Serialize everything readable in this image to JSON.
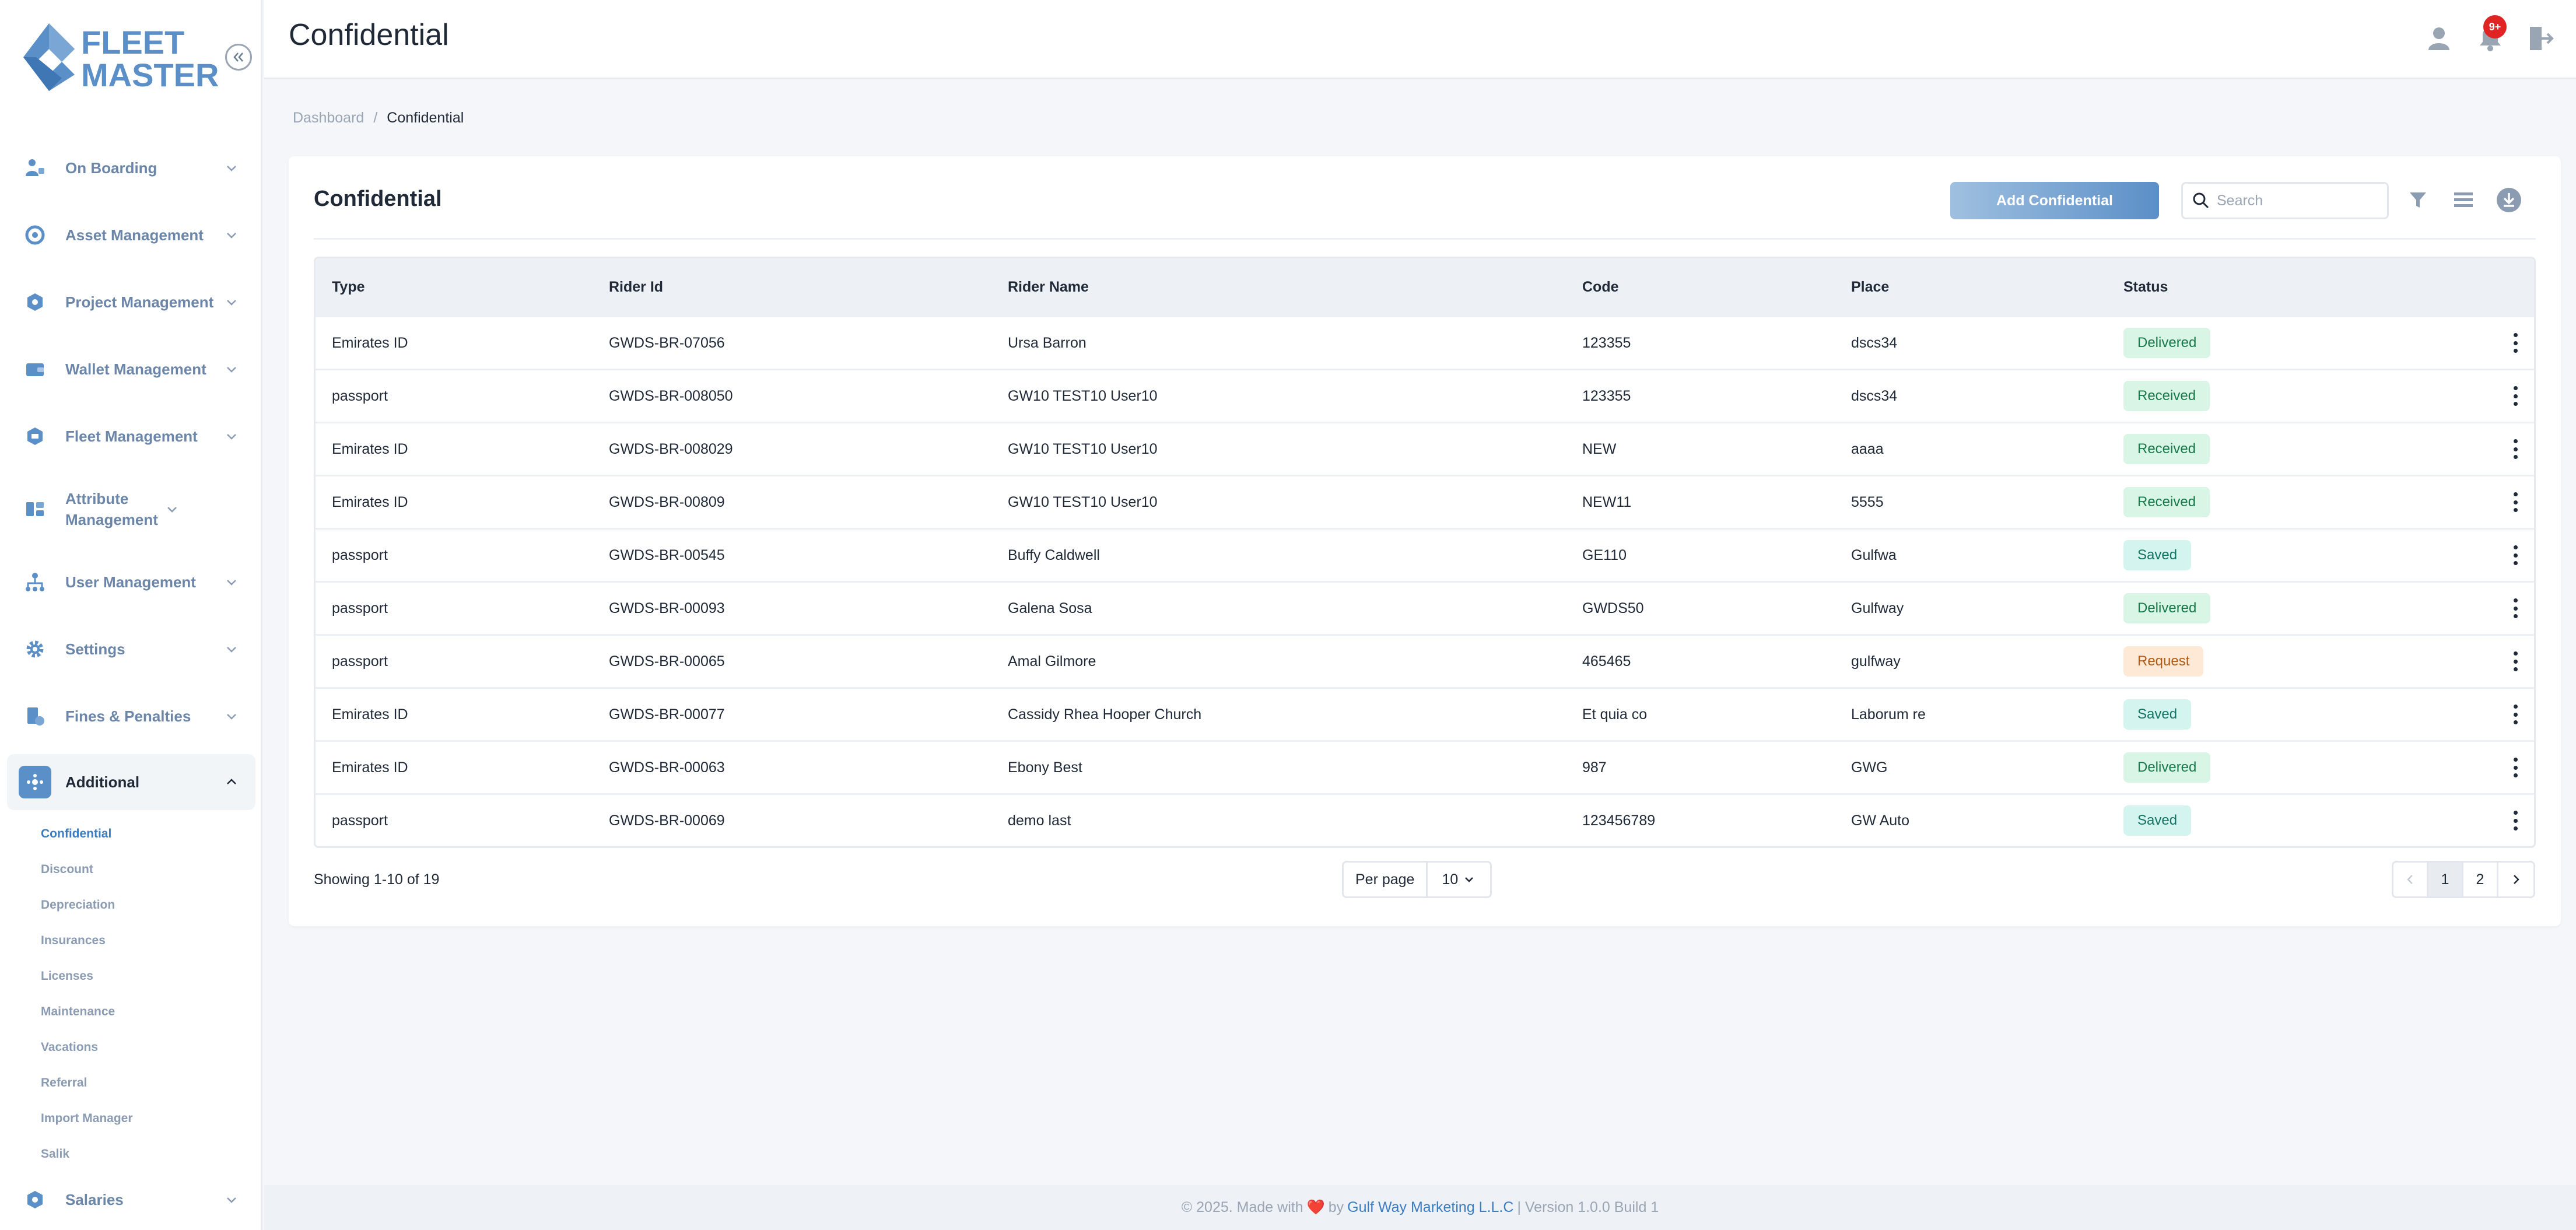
{
  "brand": {
    "line1": "FLEET",
    "line2": "MASTER"
  },
  "sidebar": {
    "items": [
      {
        "label": "On Boarding",
        "icon": "onboarding-icon"
      },
      {
        "label": "Asset Management",
        "icon": "asset-icon"
      },
      {
        "label": "Project Management",
        "icon": "project-icon"
      },
      {
        "label": "Wallet Management",
        "icon": "wallet-icon"
      },
      {
        "label": "Fleet Management",
        "icon": "fleet-icon"
      },
      {
        "label": "Attribute Management",
        "icon": "attribute-icon"
      },
      {
        "label": "User Management",
        "icon": "user-management-icon"
      },
      {
        "label": "Settings",
        "icon": "gear-icon"
      },
      {
        "label": "Fines & Penalties",
        "icon": "fines-icon"
      },
      {
        "label": "Additional",
        "icon": "additional-icon"
      }
    ],
    "subitems": [
      "Confidential",
      "Discount",
      "Depreciation",
      "Insurances",
      "Licenses",
      "Maintenance",
      "Vacations",
      "Referral",
      "Import Manager",
      "Salik"
    ],
    "salaries_label": "Salaries"
  },
  "header": {
    "title": "Confidential",
    "notification_count": "9+"
  },
  "breadcrumb": {
    "home": "Dashboard",
    "separator": "/",
    "current": "Confidential"
  },
  "card": {
    "title": "Confidential",
    "add_label": "Add Confidential",
    "search_placeholder": "Search"
  },
  "table": {
    "headers": [
      "Type",
      "Rider Id",
      "Rider Name",
      "Code",
      "Place",
      "Status"
    ],
    "rows": [
      {
        "type": "Emirates ID",
        "rider_id": "GWDS-BR-07056",
        "rider_name": "Ursa Barron",
        "code": "123355",
        "place": "dscs34",
        "status": "Delivered"
      },
      {
        "type": "passport",
        "rider_id": "GWDS-BR-008050",
        "rider_name": "GW10 TEST10 User10",
        "code": "123355",
        "place": "dscs34",
        "status": "Received"
      },
      {
        "type": "Emirates ID",
        "rider_id": "GWDS-BR-008029",
        "rider_name": "GW10 TEST10 User10",
        "code": "NEW",
        "place": "aaaa",
        "status": "Received"
      },
      {
        "type": "Emirates ID",
        "rider_id": "GWDS-BR-00809",
        "rider_name": "GW10 TEST10 User10",
        "code": "NEW11",
        "place": "5555",
        "status": "Received"
      },
      {
        "type": "passport",
        "rider_id": "GWDS-BR-00545",
        "rider_name": "Buffy Caldwell",
        "code": "GE110",
        "place": "Gulfwa",
        "status": "Saved"
      },
      {
        "type": "passport",
        "rider_id": "GWDS-BR-00093",
        "rider_name": "Galena Sosa",
        "code": "GWDS50",
        "place": "Gulfway",
        "status": "Delivered"
      },
      {
        "type": "passport",
        "rider_id": "GWDS-BR-00065",
        "rider_name": "Amal Gilmore",
        "code": "465465",
        "place": "gulfway",
        "status": "Request"
      },
      {
        "type": "Emirates ID",
        "rider_id": "GWDS-BR-00077",
        "rider_name": "Cassidy Rhea Hooper Church",
        "code": "Et quia co",
        "place": "Laborum re",
        "status": "Saved"
      },
      {
        "type": "Emirates ID",
        "rider_id": "GWDS-BR-00063",
        "rider_name": "Ebony Best",
        "code": "987",
        "place": "GWG",
        "status": "Delivered"
      },
      {
        "type": "passport",
        "rider_id": "GWDS-BR-00069",
        "rider_name": "demo last",
        "code": "123456789",
        "place": "GW Auto",
        "status": "Saved"
      }
    ]
  },
  "status_colors": {
    "Delivered": {
      "bg": "#d9f5e6",
      "fg": "#16794a"
    },
    "Received": {
      "bg": "#d9f5e6",
      "fg": "#16794a"
    },
    "Saved": {
      "bg": "#d4f5ef",
      "fg": "#137363"
    },
    "Request": {
      "bg": "#fde9d6",
      "fg": "#b45a14"
    }
  },
  "pagination": {
    "showing": "Showing 1-10 of 19",
    "per_page_label": "Per page",
    "per_page_value": "10",
    "pages": [
      "1",
      "2"
    ]
  },
  "footer": {
    "prefix": "© 2025. Made with",
    "heart": "❤️",
    "by": "by",
    "company": "Gulf Way Marketing L.L.C",
    "version": "| Version 1.0.0 Build 1"
  },
  "colors": {
    "accent": "#5b8fc7",
    "sidebar_text": "#6b86a8",
    "link": "#3b7cc0"
  }
}
